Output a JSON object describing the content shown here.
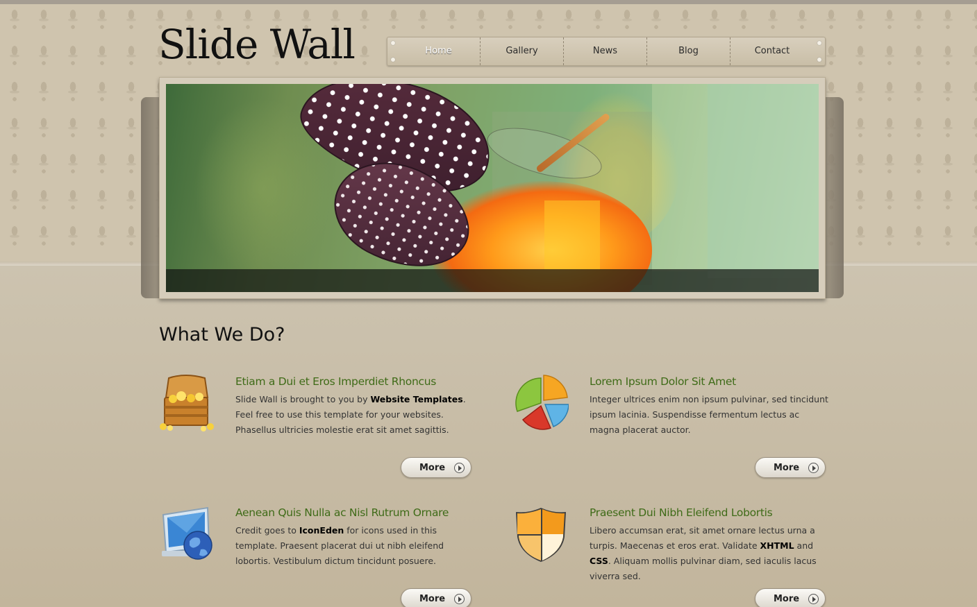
{
  "site": {
    "logo": "Slide Wall"
  },
  "nav": {
    "items": [
      {
        "label": "Home",
        "active": true
      },
      {
        "label": "Gallery",
        "active": false
      },
      {
        "label": "News",
        "active": false
      },
      {
        "label": "Blog",
        "active": false
      },
      {
        "label": "Contact",
        "active": false
      }
    ]
  },
  "main": {
    "title": "What We Do?",
    "features": [
      {
        "icon": "treasure-chest-icon",
        "title": "Etiam a Dui et Eros Imperdiet Rhoncus",
        "text_1": "Slide Wall is brought to you by ",
        "bold_1": "Website Templates",
        "text_2": ". Feel free to use this template for your websites. Phasellus ultricies molestie erat sit amet sagittis.",
        "more": "More"
      },
      {
        "icon": "pie-chart-icon",
        "title": "Lorem Ipsum Dolor Sit Amet",
        "text_1": "Integer ultrices enim non ipsum pulvinar, sed tincidunt ipsum lacinia. Suspendisse fermentum lectus ac magna placerat auctor.",
        "more": "More"
      },
      {
        "icon": "monitor-globe-icon",
        "title": "Aenean Quis Nulla ac Nisl Rutrum Ornare",
        "text_1": "Credit goes to ",
        "bold_1": "IconEden",
        "text_2": " for icons used in this template. Praesent placerat dui ut nibh eleifend lobortis. Vestibulum dictum tincidunt posuere.",
        "more": "More"
      },
      {
        "icon": "shield-icon",
        "title": "Praesent Dui Nibh Eleifend Lobortis",
        "text_1": "Libero accumsan erat, sit amet ornare lectus urna a turpis. Maecenas et eros erat. Validate ",
        "bold_1": "XHTML",
        "text_2": " and ",
        "bold_2": "CSS",
        "text_3": ". Aliquam mollis pulvinar diam, sed iaculis lacus viverra sed.",
        "more": "More"
      }
    ]
  },
  "colors": {
    "heading_green": "#3f6b18",
    "background": "#c9bea7"
  }
}
